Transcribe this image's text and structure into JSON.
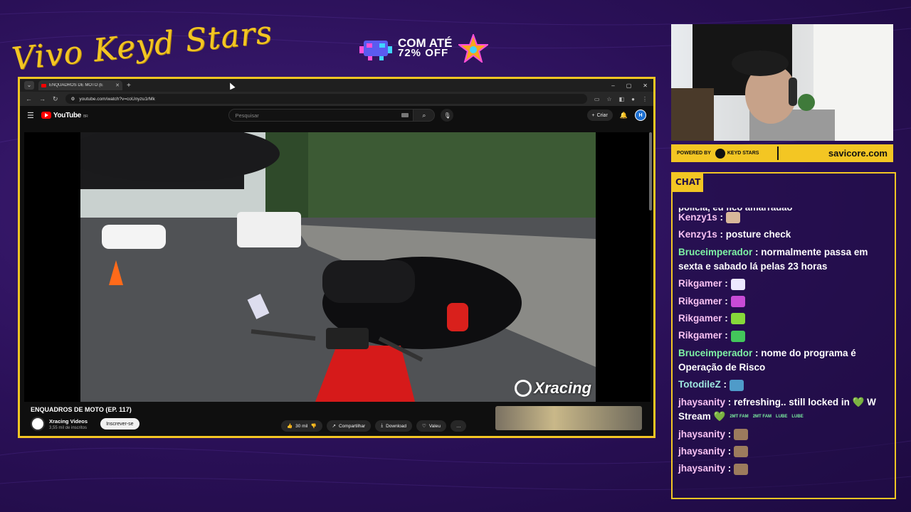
{
  "overlay": {
    "brand_text": "Vivo Keyd Stars",
    "promo_line1": "COM ATÉ",
    "promo_line2": "72% OFF"
  },
  "browser": {
    "tab_title": "ENQUADROS DE MOTO (E",
    "url": "youtube.com/watch?v=coUnyzu1rMk",
    "window_controls": [
      "–",
      "▢",
      "✕"
    ]
  },
  "youtube": {
    "logo_text": "YouTube",
    "logo_region": "BR",
    "search_placeholder": "Pesquisar",
    "create_label": "Criar",
    "avatar_letter": "H"
  },
  "video": {
    "watermark": "Xracing",
    "title": "ENQUADROS DE MOTO (EP. 117)",
    "channel_name": "Xracing Videos",
    "channel_subs": "3,55 mil de inscritos",
    "subscribe_label": "Inscrever-se",
    "likes_label": "30 mil",
    "share_label": "Compartilhar",
    "download_label": "Download",
    "thanks_label": "Valeu",
    "more_label": "…"
  },
  "sponsor": {
    "powered_label": "POWERED BY",
    "keyd_label": "KEYD STARS",
    "savi_label": "savicore.com"
  },
  "chat": {
    "header": "CHAT",
    "partial_top": "polícia, eu fico amarradão",
    "messages": [
      {
        "user": "Kenzy1s",
        "text": "",
        "emote": "#d8b89a",
        "color": "pink"
      },
      {
        "user": "Kenzy1s",
        "text": "posture check",
        "emote": "",
        "color": "pink"
      },
      {
        "user": "Bruceimperador",
        "text": "normalmente passa em sexta e sabado lá pelas 23 horas",
        "emote": "",
        "color": "green"
      },
      {
        "user": "Rikgamer",
        "text": "",
        "emote": "#ece8ff",
        "color": "pink"
      },
      {
        "user": "Rikgamer",
        "text": "",
        "emote": "#c94bd6",
        "color": "pink"
      },
      {
        "user": "Rikgamer",
        "text": "",
        "emote": "#86d93a",
        "color": "pink"
      },
      {
        "user": "Rikgamer",
        "text": "",
        "emote": "#43c65b",
        "color": "pink"
      },
      {
        "user": "Bruceimperador",
        "text": "nome do programa é Operação de Risco",
        "emote": "",
        "color": "green"
      },
      {
        "user": "TotodileZ",
        "text": "",
        "emote": "#4f9bc9",
        "color": "teal"
      },
      {
        "user": "jhaysanity",
        "text": "refreshing.. still locked in 💚 W Stream 💚",
        "emote": "",
        "color": "pink"
      },
      {
        "user": "jhaysanity",
        "text": "",
        "emote": "#9c7b5d",
        "color": "pink"
      },
      {
        "user": "jhaysanity",
        "text": "",
        "emote": "#9c7b5d",
        "color": "pink"
      },
      {
        "user": "jhaysanity",
        "text": "",
        "emote": "#9c7b5d",
        "color": "pink"
      }
    ],
    "small_emotes": [
      "2MT FAM",
      "2MT FAM",
      "LUBE",
      "LUBE"
    ]
  }
}
